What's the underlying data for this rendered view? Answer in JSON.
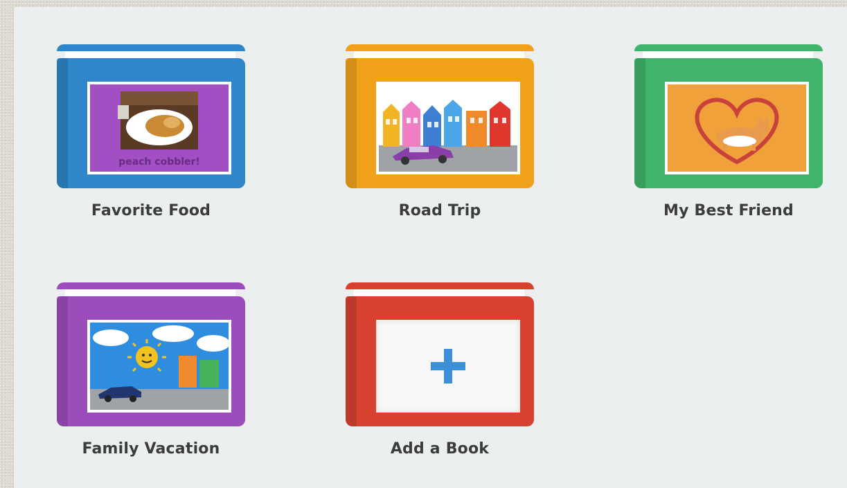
{
  "books": [
    {
      "label": "Favorite Food",
      "color": "#2f86c9",
      "art": "food-photo-cover",
      "cover_caption": "peach cobbler!"
    },
    {
      "label": "Road Trip",
      "color": "#f1a21a",
      "art": "street-car-cover"
    },
    {
      "label": "My Best Friend",
      "color": "#3fb46a",
      "art": "heart-corgi-cover"
    },
    {
      "label": "Family Vacation",
      "color": "#9b4dbc",
      "art": "sunny-drawing-cover"
    }
  ],
  "add_book": {
    "label": "Add a Book",
    "color": "#d8412f",
    "icon": "plus-icon",
    "icon_color": "#3a8fd6"
  }
}
